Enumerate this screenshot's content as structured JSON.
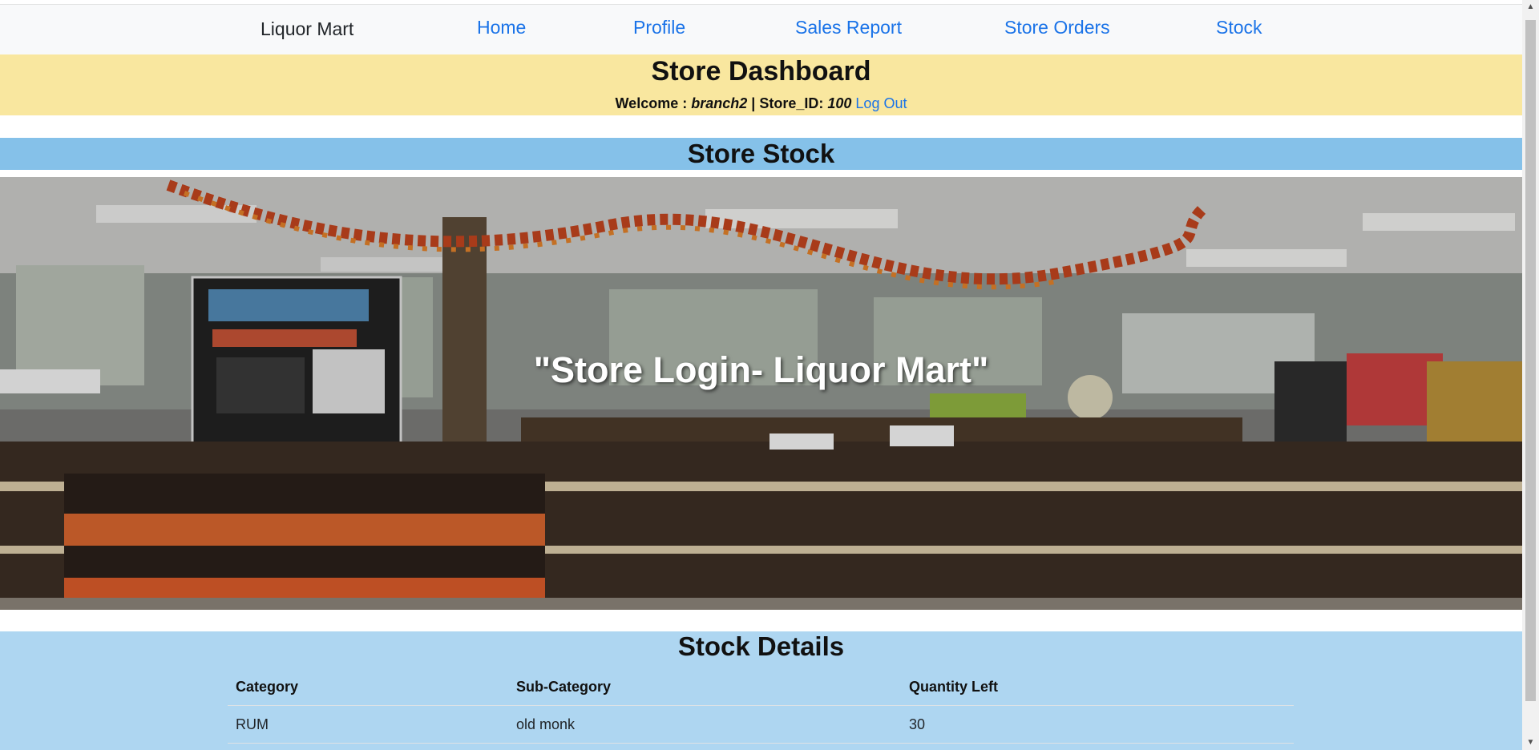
{
  "nav": {
    "brand": "Liquor Mart",
    "links": [
      "Home",
      "Profile",
      "Sales Report",
      "Store Orders",
      "Stock"
    ]
  },
  "dashboard": {
    "title": "Store Dashboard",
    "welcome_prefix": "Welcome :",
    "username": "branch2",
    "store_id_label": "| Store_ID:",
    "store_id": "100",
    "logout_label": "Log Out"
  },
  "stock_section": {
    "title": "Store Stock",
    "hero_caption": "\"Store Login- Liquor Mart\""
  },
  "stock_details": {
    "title": "Stock Details",
    "columns": [
      "Category",
      "Sub-Category",
      "Quantity Left"
    ],
    "rows": [
      [
        "RUM",
        "old monk",
        "30"
      ]
    ]
  },
  "colors": {
    "navbar_bg": "#f8f9fa",
    "link": "#1a73e8",
    "dashboard_bg": "#f9e79f",
    "stock_bar_bg": "#85c1e9",
    "details_bg": "#aed6f1"
  },
  "icons": [
    "scroll-up-arrow-icon",
    "scroll-down-arrow-icon"
  ]
}
